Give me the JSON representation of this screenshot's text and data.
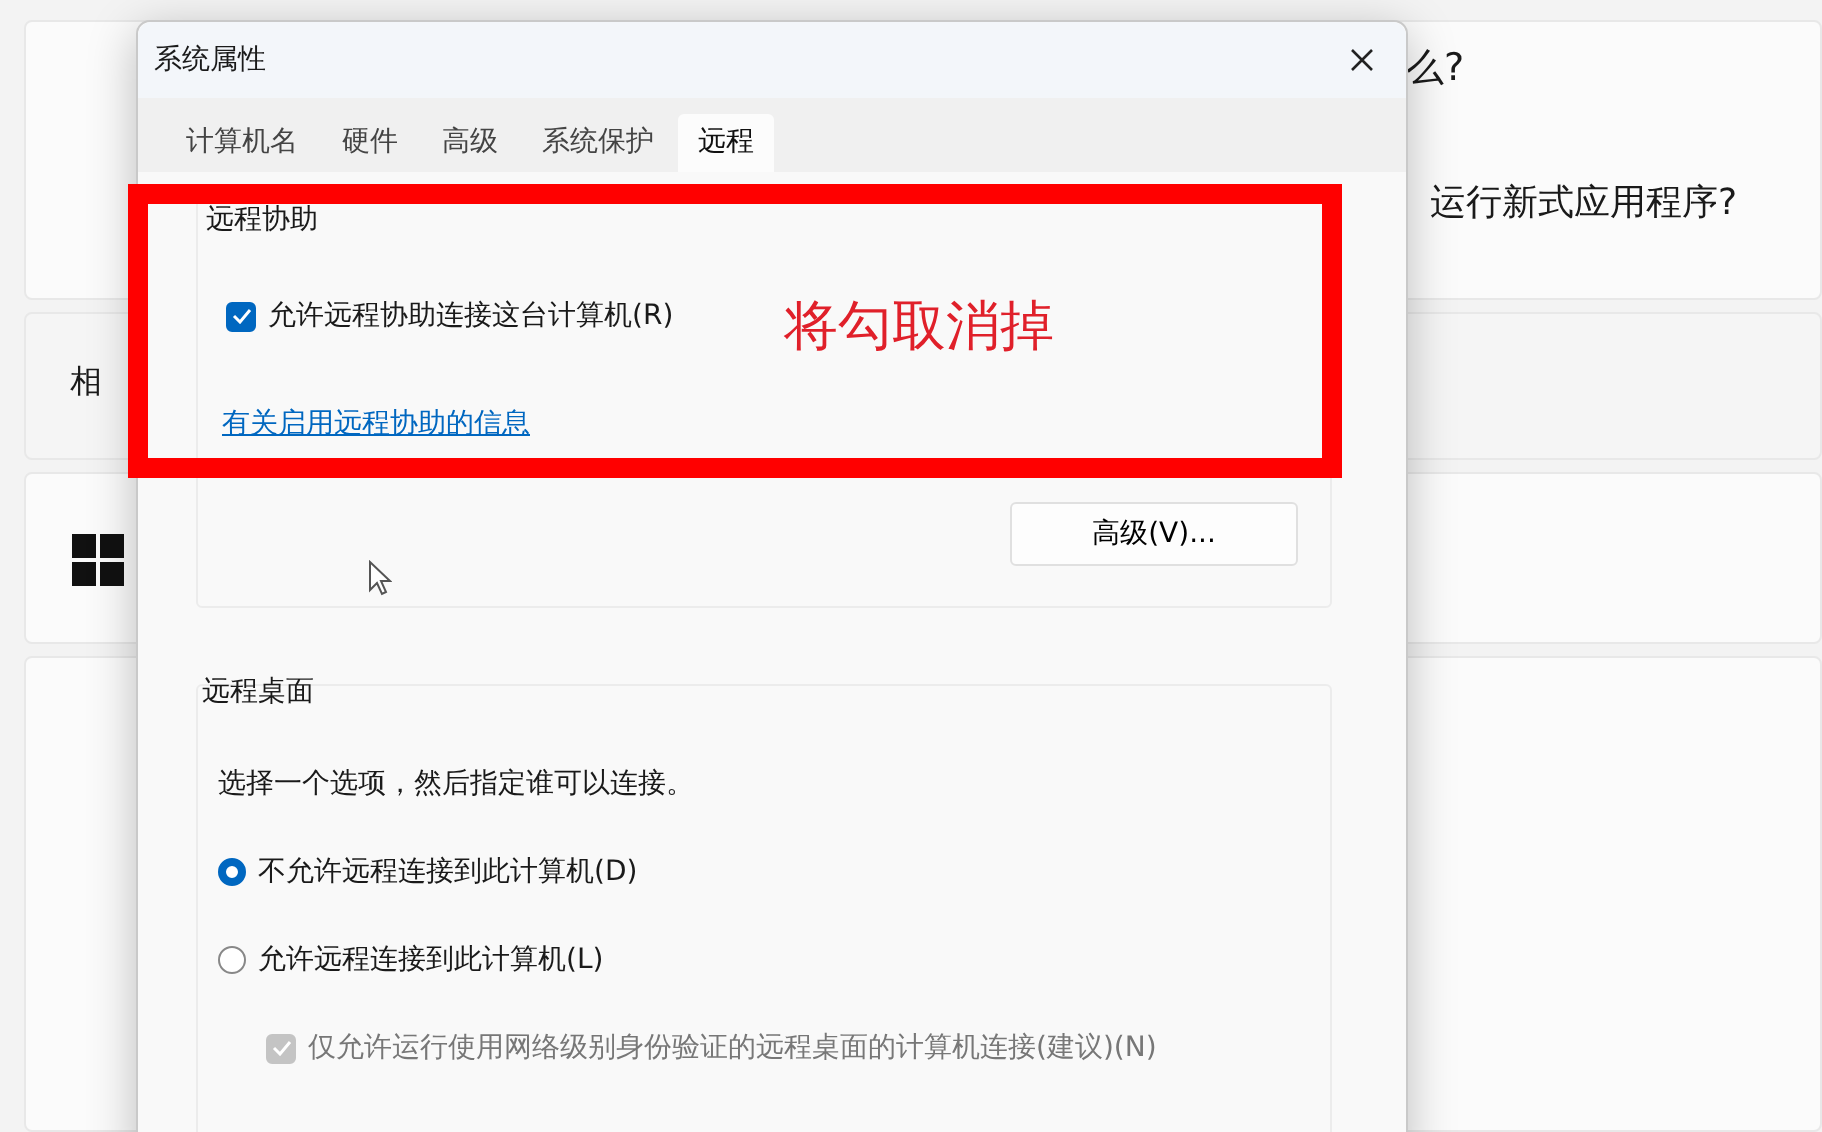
{
  "background": {
    "heading": "么?",
    "question": "运行新式应用程序?",
    "related": "相"
  },
  "dialog": {
    "title": "系统属性",
    "tabs": [
      {
        "label": "计算机名",
        "selected": false
      },
      {
        "label": "硬件",
        "selected": false
      },
      {
        "label": "高级",
        "selected": false
      },
      {
        "label": "系统保护",
        "selected": false
      },
      {
        "label": "远程",
        "selected": true
      }
    ],
    "remote_assistance": {
      "title": "远程协助",
      "checkbox": {
        "label": "允许远程协助连接这台计算机(R)",
        "checked": true
      },
      "link": "有关启用远程协助的信息",
      "advanced_button": "高级(V)..."
    },
    "remote_desktop": {
      "title": "远程桌面",
      "instruction": "选择一个选项，然后指定谁可以连接。",
      "options": [
        {
          "label": "不允许远程连接到此计算机(D)",
          "selected": true
        },
        {
          "label": "允许远程连接到此计算机(L)",
          "selected": false
        }
      ],
      "nla": {
        "label": "仅允许运行使用网络级别身份验证的远程桌面的计算机连接(建议)(N)",
        "checked": true,
        "disabled": true
      }
    }
  },
  "annotation": {
    "text": "将勾取消掉"
  }
}
